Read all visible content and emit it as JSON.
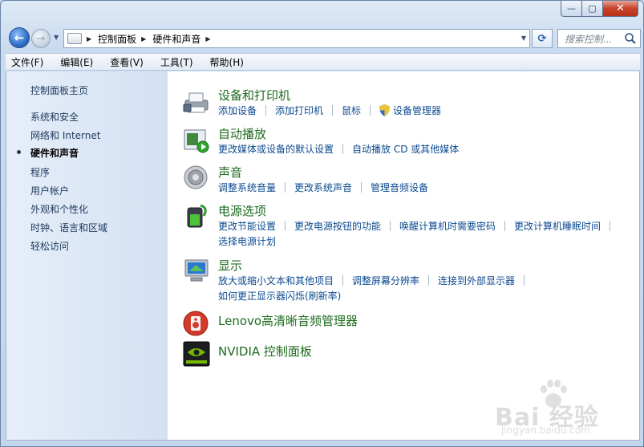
{
  "window": {
    "caption": {
      "minimize": "—",
      "maximize": "▢",
      "close": "✕"
    }
  },
  "nav": {
    "breadcrumbs": [
      "控制面板",
      "硬件和声音"
    ],
    "search_placeholder": "搜索控制..."
  },
  "menu": {
    "items": [
      "文件(F)",
      "编辑(E)",
      "查看(V)",
      "工具(T)",
      "帮助(H)"
    ]
  },
  "sidebar": {
    "items": [
      {
        "label": "控制面板主页",
        "active": false
      },
      {
        "label": "系统和安全",
        "active": false
      },
      {
        "label": "网络和 Internet",
        "active": false
      },
      {
        "label": "硬件和声音",
        "active": true
      },
      {
        "label": "程序",
        "active": false
      },
      {
        "label": "用户帐户",
        "active": false
      },
      {
        "label": "外观和个性化",
        "active": false
      },
      {
        "label": "时钟、语言和区域",
        "active": false
      },
      {
        "label": "轻松访问",
        "active": false
      }
    ]
  },
  "categories": [
    {
      "title": "设备和打印机",
      "icon": "printer-icon",
      "links": [
        [
          "添加设备",
          "添加打印机",
          "鼠标",
          "设备管理器"
        ]
      ]
    },
    {
      "title": "自动播放",
      "icon": "autoplay-icon",
      "links": [
        [
          "更改媒体或设备的默认设置",
          "自动播放 CD 或其他媒体"
        ]
      ]
    },
    {
      "title": "声音",
      "icon": "speaker-icon",
      "links": [
        [
          "调整系统音量",
          "更改系统声音",
          "管理音频设备"
        ]
      ]
    },
    {
      "title": "电源选项",
      "icon": "battery-icon",
      "links": [
        [
          "更改节能设置",
          "更改电源按钮的功能",
          "唤醒计算机时需要密码",
          "更改计算机睡眠时间"
        ],
        [
          "选择电源计划"
        ]
      ]
    },
    {
      "title": "显示",
      "icon": "monitor-icon",
      "links": [
        [
          "放大或缩小文本和其他项目",
          "调整屏幕分辨率",
          "连接到外部显示器"
        ],
        [
          "如何更正显示器闪烁(刷新率)"
        ]
      ]
    },
    {
      "title": "Lenovo高清晰音频管理器",
      "icon": "lenovo-audio-icon",
      "links": []
    },
    {
      "title": "NVIDIA 控制面板",
      "icon": "nvidia-icon",
      "links": []
    }
  ],
  "watermark": {
    "text": "Bai 经验",
    "sub": "jingyan.baidu.com"
  }
}
